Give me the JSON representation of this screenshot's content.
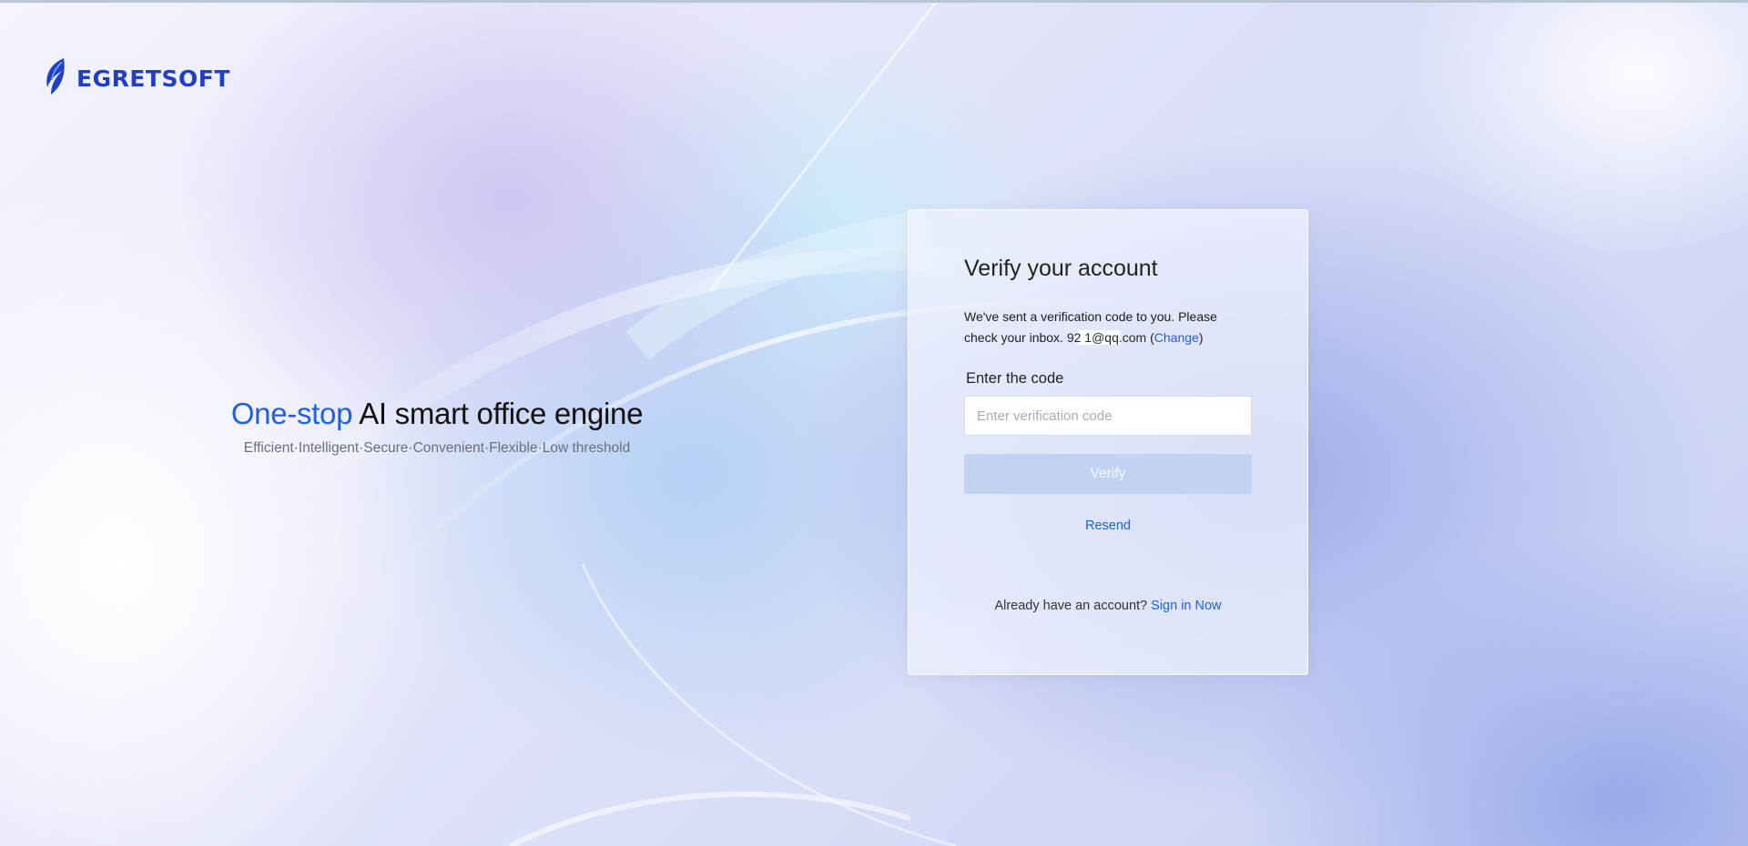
{
  "brand": {
    "logo_text": "EGRETSOFT",
    "logo_icon": "egret-feather-icon",
    "color": "#1f3fc9"
  },
  "hero": {
    "title_accent": "One-stop",
    "title_rest": " AI smart office engine",
    "subtitle": "Efficient·Intelligent·Secure·Convenient·Flexible·Low threshold",
    "accent_color": "#1f5fe6"
  },
  "verify": {
    "title": "Verify your account",
    "desc_prefix": "We've sent a verification code to you. Please check your inbox. ",
    "email": "92       1@qq.com",
    "change_open": " (",
    "change_link": "Change",
    "change_close": ")",
    "code_label": "Enter the code",
    "code_value": "",
    "code_placeholder": "Enter verification code",
    "verify_button": "Verify",
    "resend_link": "Resend",
    "already_text": "Already have an account? ",
    "signin_link": "Sign in Now"
  }
}
